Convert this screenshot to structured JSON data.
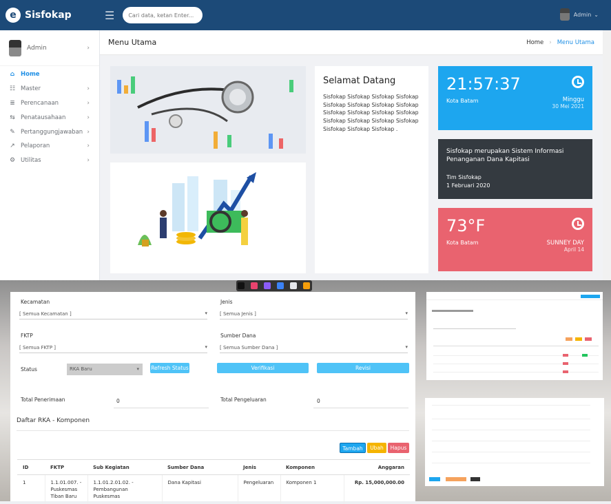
{
  "header": {
    "brand": "Sisfokap",
    "search_placeholder": "Cari data, ketan Enter...",
    "user": "Admin"
  },
  "sidebar": {
    "user": "Admin",
    "items": [
      {
        "label": "Home",
        "icon": "home-icon",
        "active": true
      },
      {
        "label": "Master",
        "icon": "list-icon"
      },
      {
        "label": "Perencanaan",
        "icon": "stack-icon"
      },
      {
        "label": "Penatausahaan",
        "icon": "transfer-icon"
      },
      {
        "label": "Pertanggungjawaban",
        "icon": "edit-icon"
      },
      {
        "label": "Pelaporan",
        "icon": "trend-icon"
      },
      {
        "label": "Utilitas",
        "icon": "gear-icon"
      }
    ]
  },
  "main": {
    "title": "Menu Utama",
    "breadcrumb": [
      "Home",
      "Menu Utama"
    ],
    "welcome": {
      "title": "Selamat Datang",
      "text": "Sisfokap Sisfokap Sisfokap Sisfokap Sisfokap Sisfokap Sisfokap Sisfokap Sisfokap Sisfokap Sisfokap Sisfokap Sisfokap Sisfokap Sisfokap Sisfokap Sisfokap Sisfokap Sisfokap ."
    },
    "clock_card": {
      "time": "21:57:37",
      "location": "Kota Batam",
      "day": "Minggu",
      "date": "30 Mei 2021"
    },
    "info_card": {
      "text": "Sisfokap merupakan Sistem Informasi Penanganan Dana Kapitasi",
      "team": "Tim Sisfokap",
      "date": "1 Februari 2020"
    },
    "weather_card": {
      "temp": "73°F",
      "location": "Kota Batam",
      "condition": "SUNNEY DAY",
      "date": "April 14"
    }
  },
  "form": {
    "kecamatan_label": "Kecamatan",
    "kecamatan_value": "[ Semua Kecamatan ]",
    "jenis_label": "Jenis",
    "jenis_value": "[ Semua Jenis ]",
    "fktp_label": "FKTP",
    "fktp_value": "[ Semua FKTP ]",
    "sumber_label": "Sumber Dana",
    "sumber_value": "[ Semua Sumber Dana ]",
    "status_label": "Status",
    "status_value": "RKA Baru",
    "refresh_button": "Refresh Status",
    "verifikasi_button": "Verifikasi",
    "revisi_button": "Revisi",
    "total_penerimaan_label": "Total Penerimaan",
    "total_penerimaan_value": "0",
    "total_pengeluaran_label": "Total Pengeluaran",
    "total_pengeluaran_value": "0",
    "section_title": "Daftar RKA - Komponen",
    "tambah_button": "Tambah",
    "ubah_button": "Ubah",
    "hapus_button": "Hapus",
    "columns": [
      "ID",
      "FKTP",
      "Sub Kegiatan",
      "Sumber Dana",
      "Jenis",
      "Komponen",
      "Anggaran"
    ],
    "rows": [
      [
        "1",
        "1.1.01.007. - Puskesmas Tiban Baru",
        "1.1.01.2.01.02. - Pembangunan Puskesmas",
        "Dana Kapitasi",
        "Pengeluaran",
        "Komponen 1",
        "Rp. 15,000,000.00"
      ]
    ]
  },
  "colors": {
    "topbar": "#1c4a78",
    "accent": "#1f8fe5",
    "blue_card": "#1da6ef",
    "dark_card": "#343a40",
    "red_card": "#e9636f"
  }
}
